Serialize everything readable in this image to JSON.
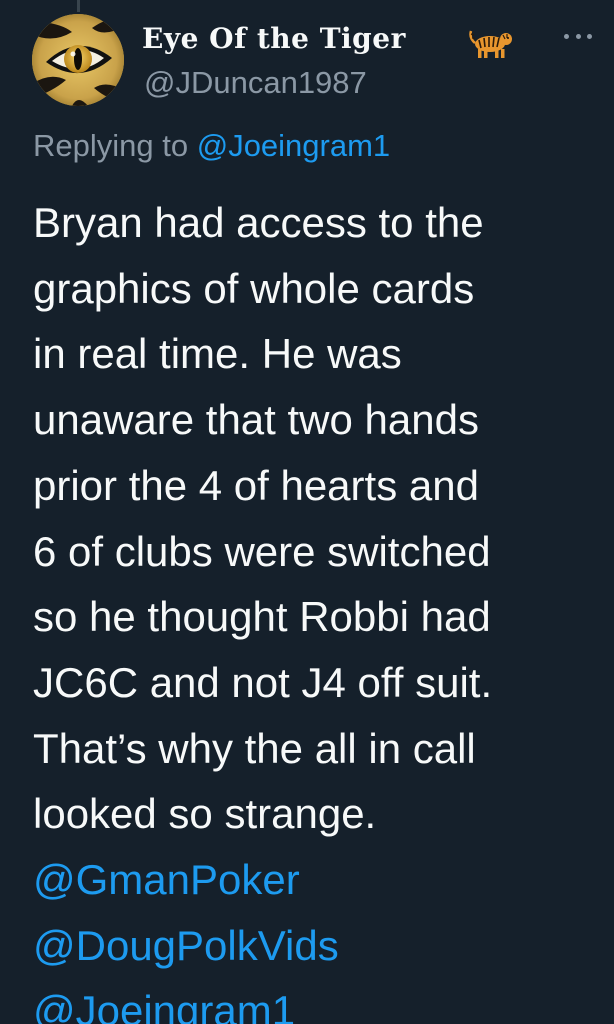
{
  "tweet": {
    "author": {
      "display_name": "Eye Of the Tiger",
      "name_emoji": "tiger-emoji",
      "handle": "@JDuncan1987",
      "avatar": "tiger-eye-avatar"
    },
    "more_icon": "more-horizontal-icon",
    "replying": {
      "prefix": "Replying to",
      "mention": "@Joeingram1"
    },
    "body": "Bryan had access to the\ngraphics of whole cards\nin real time. He was\nunaware that two hands\nprior the 4 of hearts and\n6 of clubs were switched\nso he thought Robbi had\nJC6C and not J4 off suit.\nThat’s why the all in call\nlooked so strange.",
    "mentions": [
      "@GmanPoker",
      "@DougPolkVids",
      "@Joeingram1"
    ]
  },
  "colors": {
    "background": "#15202b",
    "primary_text": "#f7f9f9",
    "secondary_text": "#8b98a5",
    "link": "#1d9bf0"
  }
}
